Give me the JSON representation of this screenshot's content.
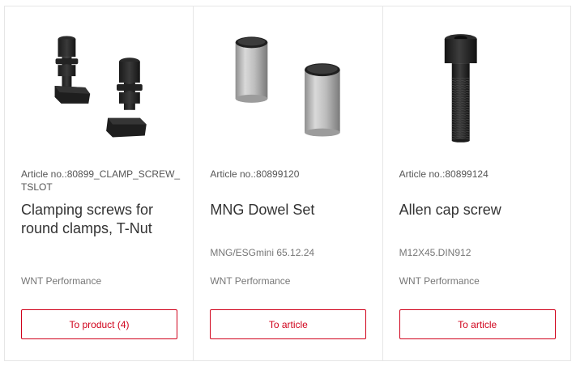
{
  "products": [
    {
      "image": "t-slot-clamping-screws-image",
      "article_label": "Article no.:80899_CLAMP_SCREW_TSLOT",
      "title": "Clamping screws for round clamps, T-Nut",
      "subline": "",
      "brand": "WNT Performance",
      "button_label": "To product (4)"
    },
    {
      "image": "dowel-pins-image",
      "article_label": "Article no.:80899120",
      "title": "MNG Dowel Set",
      "subline": "MNG/ESGmini 65.12.24",
      "brand": "WNT Performance",
      "button_label": "To article"
    },
    {
      "image": "allen-cap-screw-image",
      "article_label": "Article no.:80899124",
      "title": "Allen cap screw",
      "subline": "M12X45.DIN912",
      "brand": "WNT Performance",
      "button_label": "To article"
    }
  ],
  "colors": {
    "accent": "#d0021b",
    "border": "#e6e6e6",
    "muted_text": "#777777"
  }
}
